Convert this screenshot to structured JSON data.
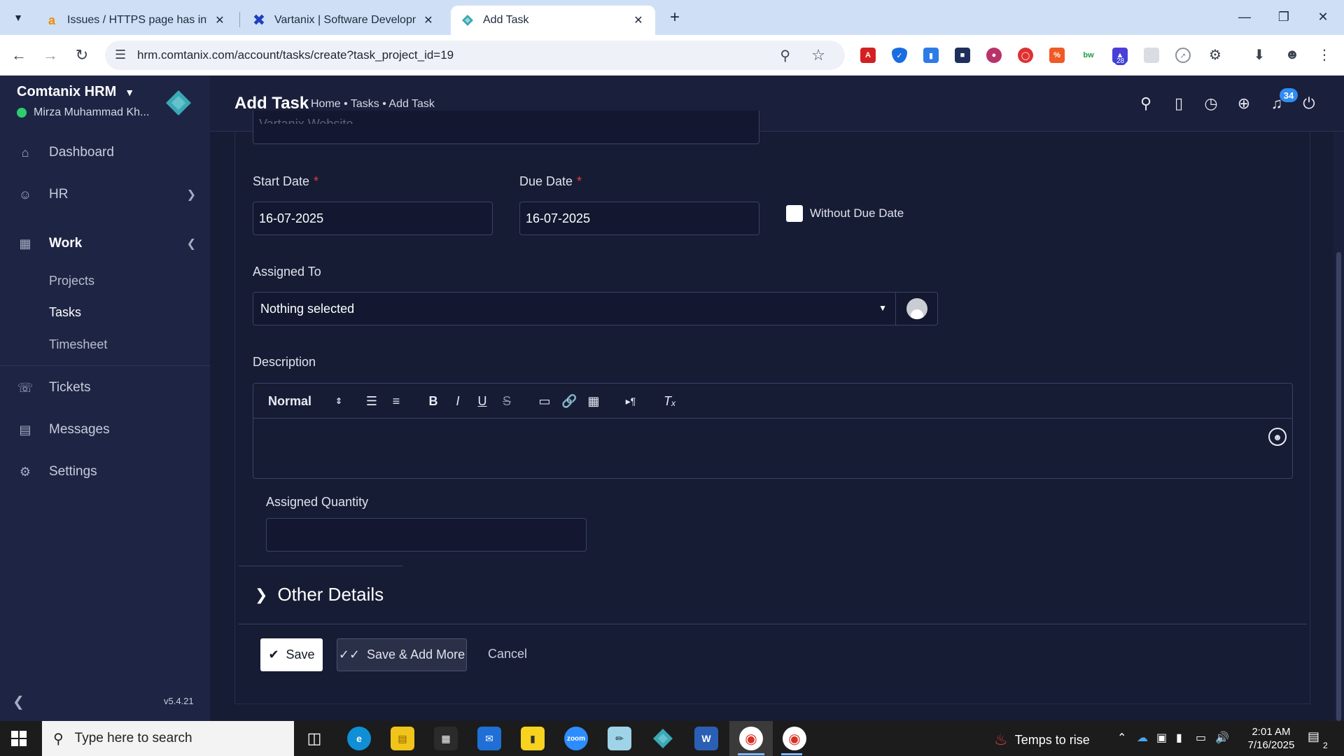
{
  "browser": {
    "tabs": [
      {
        "title": "Issues / HTTPS page has interne",
        "favicon": "amazon-a-icon"
      },
      {
        "title": "Vartanix | Software Developmen",
        "favicon": "x-logo-icon"
      },
      {
        "title": "Add Task",
        "favicon": "comtanix-logo-icon",
        "active": true
      }
    ],
    "url": "hrm.comtanix.com/account/tasks/create?task_project_id=19",
    "extension_badge": "28"
  },
  "app": {
    "brand": "Comtanix HRM",
    "user": "Mirza Muhammad Kh...",
    "version": "v5.4.21",
    "nav": [
      {
        "label": "Dashboard",
        "icon": "home-icon"
      },
      {
        "label": "HR",
        "icon": "users-icon"
      },
      {
        "label": "Work",
        "icon": "briefcase-icon"
      },
      {
        "label": "Tickets",
        "icon": "headset-icon"
      },
      {
        "label": "Messages",
        "icon": "message-icon"
      },
      {
        "label": "Settings",
        "icon": "gear-icon"
      }
    ],
    "work_sub": [
      "Projects",
      "Tasks",
      "Timesheet"
    ]
  },
  "header": {
    "title": "Add Task",
    "breadcrumb": "Home • Tasks • Add Task",
    "notification_count": "34"
  },
  "form": {
    "project_value": "Vartanix Website",
    "start_date_label": "Start Date",
    "start_date_value": "16-07-2025",
    "due_date_label": "Due Date",
    "due_date_value": "16-07-2025",
    "without_due_date_label": "Without Due Date",
    "assigned_to_label": "Assigned To",
    "assigned_to_value": "Nothing selected",
    "description_label": "Description",
    "editor_format": "Normal",
    "assigned_quantity_label": "Assigned Quantity",
    "other_details_label": "Other Details",
    "save_label": "Save",
    "save_add_more_label": "Save & Add More",
    "cancel_label": "Cancel"
  },
  "taskbar": {
    "search_placeholder": "Type here to search",
    "weather": "Temps to rise",
    "time": "2:01 AM",
    "date": "7/16/2025",
    "notifications": "2"
  }
}
